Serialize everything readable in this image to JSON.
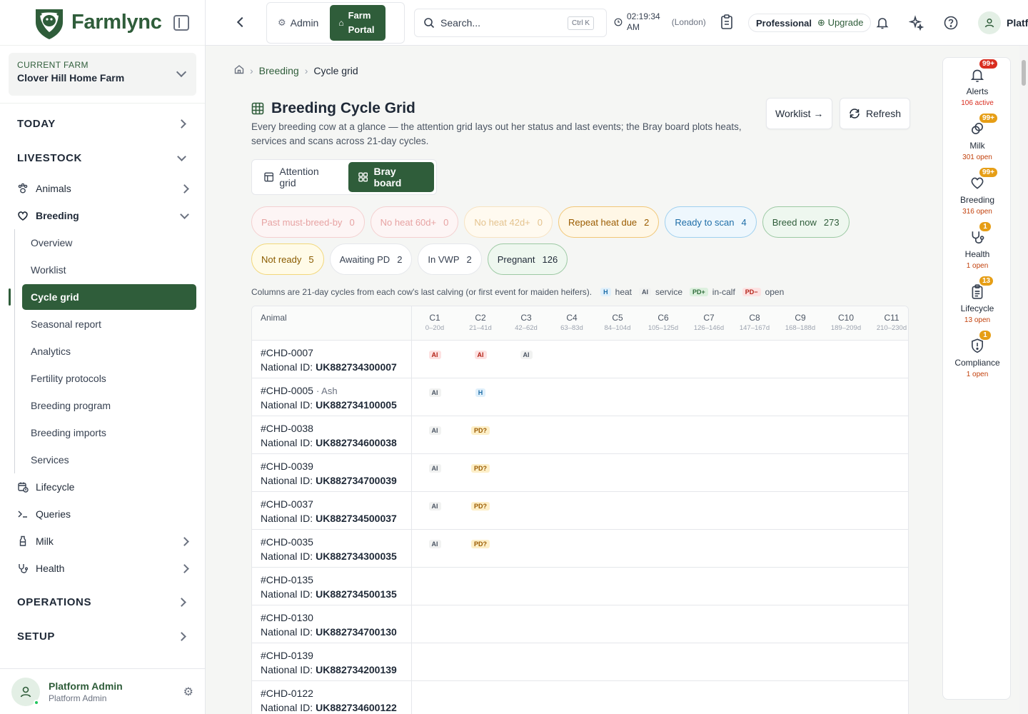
{
  "app": {
    "name": "Farmlync"
  },
  "farm": {
    "label": "CURRENT FARM",
    "name": "Clover Hill Home Farm"
  },
  "nav": {
    "today": "TODAY",
    "livestock": "LIVESTOCK",
    "animals": "Animals",
    "breeding": "Breeding",
    "breeding_sub": [
      "Overview",
      "Worklist",
      "Cycle grid",
      "Seasonal report",
      "Analytics",
      "Fertility protocols",
      "Breeding program",
      "Breeding imports",
      "Services"
    ],
    "lifecycle": "Lifecycle",
    "queries": "Queries",
    "milk": "Milk",
    "health": "Health",
    "operations": "OPERATIONS",
    "setup": "SETUP"
  },
  "user": {
    "name": "Platform Admin",
    "role": "Platform Admin",
    "short": "Platf"
  },
  "topbar": {
    "admin": "Admin",
    "farm_portal": "Farm Portal",
    "search_placeholder": "Search...",
    "shortcut": "Ctrl K",
    "time": "02:19:34",
    "ampm": "AM",
    "tz": "(London)",
    "plan": "Professional",
    "upgrade": "Upgrade"
  },
  "breadcrumb": {
    "parent": "Breeding",
    "current": "Cycle grid"
  },
  "page": {
    "title": "Breeding Cycle Grid",
    "description": "Every breeding cow at a glance — the attention grid lays out her status and last events; the Bray board plots heats, services and scans across 21-day cycles.",
    "worklist_btn": "Worklist →",
    "refresh_btn": "Refresh"
  },
  "views": {
    "attention": "Attention grid",
    "bray": "Bray board"
  },
  "chips": [
    {
      "label": "Past must-breed-by",
      "count": "0",
      "bg": "#fdf5f5",
      "border": "#f4d0d0",
      "color": "#e7a3a3"
    },
    {
      "label": "No heat 60d+",
      "count": "0",
      "bg": "#fdf5f5",
      "border": "#f4d0d0",
      "color": "#e7a3a3"
    },
    {
      "label": "No heat 42d+",
      "count": "0",
      "bg": "#fffaf0",
      "border": "#f7e3c2",
      "color": "#e4c38e"
    },
    {
      "label": "Repeat heat due",
      "count": "2",
      "bg": "#fff7e6",
      "border": "#f1c777",
      "color": "#9a5b00"
    },
    {
      "label": "Ready to scan",
      "count": "4",
      "bg": "#eef7fd",
      "border": "#9fd0ef",
      "color": "#1f6ea8"
    },
    {
      "label": "Breed now",
      "count": "273",
      "bg": "#eef7ef",
      "border": "#9cc9a3",
      "color": "#2f5d3a"
    },
    {
      "label": "Not ready",
      "count": "5",
      "bg": "#fffbe8",
      "border": "#f2d77a",
      "color": "#8a5b00"
    },
    {
      "label": "Awaiting PD",
      "count": "2",
      "bg": "#ffffff",
      "border": "#e5e7eb",
      "color": "#374151"
    },
    {
      "label": "In VWP",
      "count": "2",
      "bg": "#ffffff",
      "border": "#e5e7eb",
      "color": "#374151"
    },
    {
      "label": "Pregnant",
      "count": "126",
      "bg": "#eef7ef",
      "border": "#9cc9a3",
      "color": "#1f2937"
    }
  ],
  "legend": {
    "intro": "Columns are 21-day cycles from each cow's last calving (or first event for maiden heifers).",
    "h": "H",
    "heat": "heat",
    "ai": "AI",
    "service": "service",
    "pdp": "PD+",
    "incalf": "in-calf",
    "pdm": "PD−",
    "open": "open"
  },
  "grid": {
    "animal_header": "Animal",
    "national_label": "National ID:",
    "columns": [
      {
        "c": "C1",
        "r": "0–20d"
      },
      {
        "c": "C2",
        "r": "21–41d"
      },
      {
        "c": "C3",
        "r": "42–62d"
      },
      {
        "c": "C4",
        "r": "63–83d"
      },
      {
        "c": "C5",
        "r": "84–104d"
      },
      {
        "c": "C6",
        "r": "105–125d"
      },
      {
        "c": "C7",
        "r": "126–146d"
      },
      {
        "c": "C8",
        "r": "147–167d"
      },
      {
        "c": "C9",
        "r": "168–188d"
      },
      {
        "c": "C10",
        "r": "189–209d"
      },
      {
        "c": "C11",
        "r": "210–230d"
      }
    ],
    "rows": [
      {
        "id": "#CHD-0007",
        "name": "",
        "nid": "UK882734300007",
        "events": [
          {
            "col": 0,
            "t": "AI",
            "k": "ai-red"
          },
          {
            "col": 1,
            "t": "AI",
            "k": "ai-red"
          },
          {
            "col": 2,
            "t": "AI",
            "k": "ai"
          }
        ]
      },
      {
        "id": "#CHD-0005",
        "name": "· Ash",
        "nid": "UK882734100005",
        "events": [
          {
            "col": 0,
            "t": "AI",
            "k": "ai"
          },
          {
            "col": 1,
            "t": "H",
            "k": "h"
          }
        ]
      },
      {
        "id": "#CHD-0038",
        "name": "",
        "nid": "UK882734600038",
        "events": [
          {
            "col": 0,
            "t": "AI",
            "k": "ai"
          },
          {
            "col": 1,
            "t": "PD?",
            "k": "pdq"
          }
        ]
      },
      {
        "id": "#CHD-0039",
        "name": "",
        "nid": "UK882734700039",
        "events": [
          {
            "col": 0,
            "t": "AI",
            "k": "ai"
          },
          {
            "col": 1,
            "t": "PD?",
            "k": "pdq"
          }
        ]
      },
      {
        "id": "#CHD-0037",
        "name": "",
        "nid": "UK882734500037",
        "events": [
          {
            "col": 0,
            "t": "AI",
            "k": "ai"
          },
          {
            "col": 1,
            "t": "PD?",
            "k": "pdq"
          }
        ]
      },
      {
        "id": "#CHD-0035",
        "name": "",
        "nid": "UK882734300035",
        "events": [
          {
            "col": 0,
            "t": "AI",
            "k": "ai"
          },
          {
            "col": 1,
            "t": "PD?",
            "k": "pdq"
          }
        ]
      },
      {
        "id": "#CHD-0135",
        "name": "",
        "nid": "UK882734500135",
        "events": []
      },
      {
        "id": "#CHD-0130",
        "name": "",
        "nid": "UK882734700130",
        "events": []
      },
      {
        "id": "#CHD-0139",
        "name": "",
        "nid": "UK882734200139",
        "events": []
      },
      {
        "id": "#CHD-0122",
        "name": "",
        "nid": "UK882734600122",
        "events": []
      }
    ]
  },
  "rail": [
    {
      "label": "Alerts",
      "badge": "99+",
      "sub": "106 active",
      "icon": "bell-icon",
      "red": true
    },
    {
      "label": "Milk",
      "badge": "99+",
      "sub": "301 open",
      "icon": "milk-icon",
      "red": false
    },
    {
      "label": "Breeding",
      "badge": "99+",
      "sub": "316 open",
      "icon": "heart-icon",
      "red": false
    },
    {
      "label": "Health",
      "badge": "1",
      "sub": "1 open",
      "icon": "stethoscope-icon",
      "red": false
    },
    {
      "label": "Lifecycle",
      "badge": "13",
      "sub": "13 open",
      "icon": "clipboard-icon",
      "red": false
    },
    {
      "label": "Compliance",
      "badge": "1",
      "sub": "1 open",
      "icon": "shield-alert-icon",
      "red": false
    }
  ]
}
